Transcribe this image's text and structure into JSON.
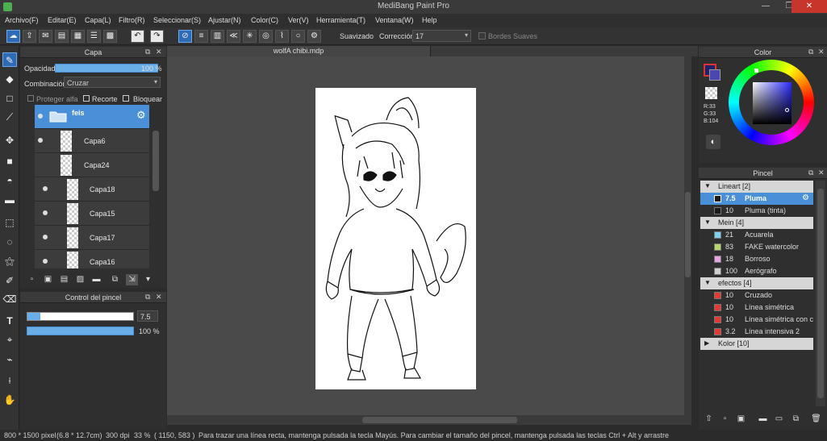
{
  "window": {
    "title": "MediBang Paint Pro",
    "minimize": "—",
    "maximize": "❐",
    "close": "✕"
  },
  "menu": [
    "Archivo(F)",
    "Editar(E)",
    "Capa(L)",
    "Filtro(R)",
    "Seleccionar(S)",
    "Ajustar(N)",
    "Color(C)",
    "Ver(V)",
    "Herramienta(T)",
    "Ventana(W)",
    "Help"
  ],
  "toolbar": {
    "smoothing_label": "Suavizado",
    "correction_label": "Corrección",
    "correction_value": "17",
    "soft_edges_label": "Bordes Suaves"
  },
  "layer_panel": {
    "title": "Capa",
    "opacity_label": "Opacidad",
    "opacity_value": "100 %",
    "opacity_fraction": 1.0,
    "blend_label": "Combinación",
    "blend_value": "Cruzar",
    "protect_alpha": "Proteger alfa",
    "clipping": "Recorte",
    "lock": "Bloquear",
    "layers": [
      {
        "name": "feis",
        "folder": true,
        "selected": true,
        "visible": true
      },
      {
        "name": "Capa6",
        "visible": true
      },
      {
        "name": "Capa24",
        "visible": false
      },
      {
        "name": "Capa18",
        "visible": true
      },
      {
        "name": "Capa15",
        "visible": true
      },
      {
        "name": "Capa17",
        "visible": true
      },
      {
        "name": "Capa16",
        "visible": true
      }
    ]
  },
  "brush_control": {
    "title": "Control del pincel",
    "size_value": "7.5",
    "size_fraction": 0.12,
    "opacity_value": "100 %",
    "opacity_fraction": 1.0
  },
  "document": {
    "tab_title": "wolfA chibi.mdp"
  },
  "color_panel": {
    "title": "Color",
    "r": "R:33",
    "g": "G:33",
    "b": "B:104",
    "foreground": "#212168",
    "background": "#ffffff"
  },
  "brush_panel": {
    "title": "Pincel",
    "groups": [
      {
        "name": "Lineart [2]",
        "expanded": true,
        "brushes": [
          {
            "size": "7.5",
            "name": "Pluma",
            "color": "#1a1a1a",
            "selected": true
          },
          {
            "size": "10",
            "name": "Pluma (tinta)",
            "color": "#1a1a1a"
          }
        ]
      },
      {
        "name": "Mein [4]",
        "expanded": true,
        "brushes": [
          {
            "size": "21",
            "name": "Acuarela",
            "color": "#7fd0ee"
          },
          {
            "size": "83",
            "name": "FAKE watercolor",
            "color": "#b5d66a"
          },
          {
            "size": "18",
            "name": "Borroso",
            "color": "#e6a5e0"
          },
          {
            "size": "100",
            "name": "Aerógrafo",
            "color": "#cfcfcf"
          }
        ]
      },
      {
        "name": "efectos [4]",
        "expanded": true,
        "brushes": [
          {
            "size": "10",
            "name": "Cruzado",
            "color": "#e53935"
          },
          {
            "size": "10",
            "name": "Línea simétrica",
            "color": "#e53935"
          },
          {
            "size": "10",
            "name": "Línea simétrica con c",
            "color": "#e53935"
          },
          {
            "size": "3.2",
            "name": "Línea intensiva 2",
            "color": "#e53935"
          }
        ]
      },
      {
        "name": "Kolor [10]",
        "expanded": false,
        "brushes": []
      }
    ]
  },
  "status": {
    "dimensions": "800 * 1500 pixel",
    "physical": "(6.8 * 12.7cm)",
    "dpi": "300 dpi",
    "zoom": "33 %",
    "cursor": "( 1150, 583 )",
    "hint": "Para trazar una línea recta, mantenga pulsada la tecla Mayús. Para cambiar el tamaño del pincel, mantenga pulsada las teclas Ctrl + Alt y arrastre"
  }
}
